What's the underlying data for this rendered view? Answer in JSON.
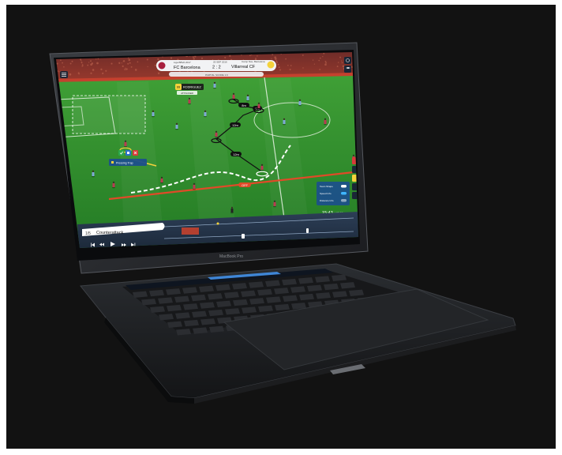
{
  "scoreboard": {
    "left_meta": "Liga BBVA 2017",
    "center_meta": "25 SEP 2016",
    "right_meta": "Camp Nou, Barcelona",
    "home_team": "FC Barcelona",
    "score": "2 : 2",
    "away_team": "Villarreal CF",
    "sub_line": "PARTIAL SCORE 1:0"
  },
  "player_tag": {
    "number": "99",
    "name": "RODRIGUEZ",
    "sub": "ATTACKER"
  },
  "distances": [
    "8m",
    "12m",
    "12m",
    "8m"
  ],
  "offside_label": "OFF",
  "tactic_field": {
    "label": "Pressing Trap"
  },
  "timeline": {
    "clip_index": "1/5",
    "clip_name": "Counterattack",
    "time": "15:43",
    "total": "/ 90:00"
  },
  "right_panel": {
    "rows": [
      "Team Shape",
      "Speed Info",
      "Distance Info"
    ]
  },
  "laptop": {
    "brand_label": "MacBook Pro"
  },
  "colors": {
    "pitch_green": "#2f8f2a",
    "offside_line": "#e04a28",
    "accent_yellow": "#f4d23b",
    "toolbar_blue": "#2a6fc9"
  }
}
